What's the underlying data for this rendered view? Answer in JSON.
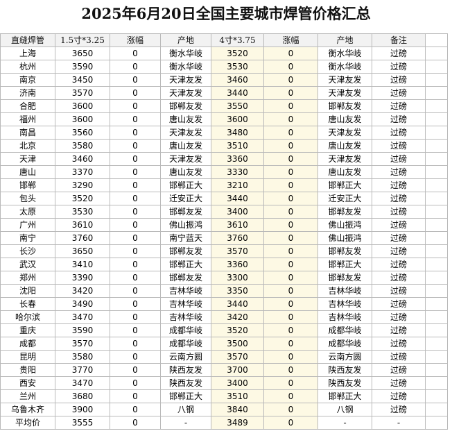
{
  "title": "2025年6月20日全国主要城市焊管价格汇总",
  "headers": [
    "直缝焊管",
    "1.5寸*3.25",
    "涨幅",
    "产地",
    "4寸*3.75",
    "涨幅",
    "产地",
    "备注"
  ],
  "rows": [
    [
      "上海",
      "3650",
      "0",
      "衡水华岐",
      "3520",
      "0",
      "衡水华岐",
      "过磅"
    ],
    [
      "杭州",
      "3590",
      "0",
      "衡水华岐",
      "3530",
      "0",
      "衡水华岐",
      "过磅"
    ],
    [
      "南京",
      "3450",
      "0",
      "天津友发",
      "3460",
      "0",
      "天津友发",
      "过磅"
    ],
    [
      "济南",
      "3570",
      "0",
      "天津友发",
      "3440",
      "0",
      "天津友发",
      "过磅"
    ],
    [
      "合肥",
      "3600",
      "0",
      "邯郸友发",
      "3550",
      "0",
      "邯郸友发",
      "过磅"
    ],
    [
      "福州",
      "3600",
      "0",
      "唐山友发",
      "3600",
      "0",
      "唐山友发",
      "过磅"
    ],
    [
      "南昌",
      "3560",
      "0",
      "天津友发",
      "3480",
      "0",
      "天津友发",
      "过磅"
    ],
    [
      "北京",
      "3580",
      "0",
      "唐山友发",
      "3510",
      "0",
      "唐山友发",
      "过磅"
    ],
    [
      "天津",
      "3460",
      "0",
      "天津友发",
      "3360",
      "0",
      "天津友发",
      "过磅"
    ],
    [
      "唐山",
      "3370",
      "0",
      "唐山友发",
      "3330",
      "0",
      "唐山友发",
      "过磅"
    ],
    [
      "邯郸",
      "3290",
      "0",
      "邯郸正大",
      "3210",
      "0",
      "邯郸正大",
      "过磅"
    ],
    [
      "包头",
      "3520",
      "0",
      "迁安正大",
      "3440",
      "0",
      "迁安正大",
      "过磅"
    ],
    [
      "太原",
      "3530",
      "0",
      "邯郸友发",
      "3400",
      "0",
      "邯郸友发",
      "过磅"
    ],
    [
      "广州",
      "3610",
      "0",
      "佛山振鸿",
      "3610",
      "0",
      "佛山振鸿",
      "过磅"
    ],
    [
      "南宁",
      "3760",
      "0",
      "南宁蓝天",
      "3760",
      "0",
      "佛山振鸿",
      "过磅"
    ],
    [
      "长沙",
      "3650",
      "0",
      "邯郸友发",
      "3570",
      "0",
      "邯郸友发",
      "过磅"
    ],
    [
      "武汉",
      "3410",
      "0",
      "邯郸正大",
      "3360",
      "0",
      "邯郸正大",
      "过磅"
    ],
    [
      "郑州",
      "3390",
      "0",
      "邯郸友发",
      "3300",
      "0",
      "邯郸友发",
      "过磅"
    ],
    [
      "沈阳",
      "3420",
      "0",
      "吉林华岐",
      "3350",
      "0",
      "吉林华岐",
      "过磅"
    ],
    [
      "长春",
      "3490",
      "0",
      "吉林华岐",
      "3440",
      "0",
      "吉林华岐",
      "过磅"
    ],
    [
      "哈尔滨",
      "3470",
      "0",
      "吉林华岐",
      "3420",
      "0",
      "吉林华岐",
      "过磅"
    ],
    [
      "重庆",
      "3590",
      "0",
      "成都华岐",
      "3520",
      "0",
      "成都华岐",
      "过磅"
    ],
    [
      "成都",
      "3570",
      "0",
      "成都华岐",
      "3500",
      "0",
      "成都华岐",
      "过磅"
    ],
    [
      "昆明",
      "3580",
      "0",
      "云南方圆",
      "3570",
      "0",
      "云南方圆",
      "过磅"
    ],
    [
      "贵阳",
      "3770",
      "0",
      "陕西友发",
      "3700",
      "0",
      "陕西友发",
      "过磅"
    ],
    [
      "西安",
      "3470",
      "0",
      "陕西友发",
      "3400",
      "0",
      "陕西友发",
      "过磅"
    ],
    [
      "兰州",
      "3680",
      "0",
      "邯郸正大",
      "3510",
      "0",
      "邯郸正大",
      "过磅"
    ],
    [
      "乌鲁木齐",
      "3900",
      "0",
      "八钢",
      "3840",
      "0",
      "八钢",
      "过磅"
    ]
  ],
  "average_row": [
    "平均价",
    "3555",
    "0",
    "-",
    "3489",
    "0",
    "-",
    "-"
  ]
}
